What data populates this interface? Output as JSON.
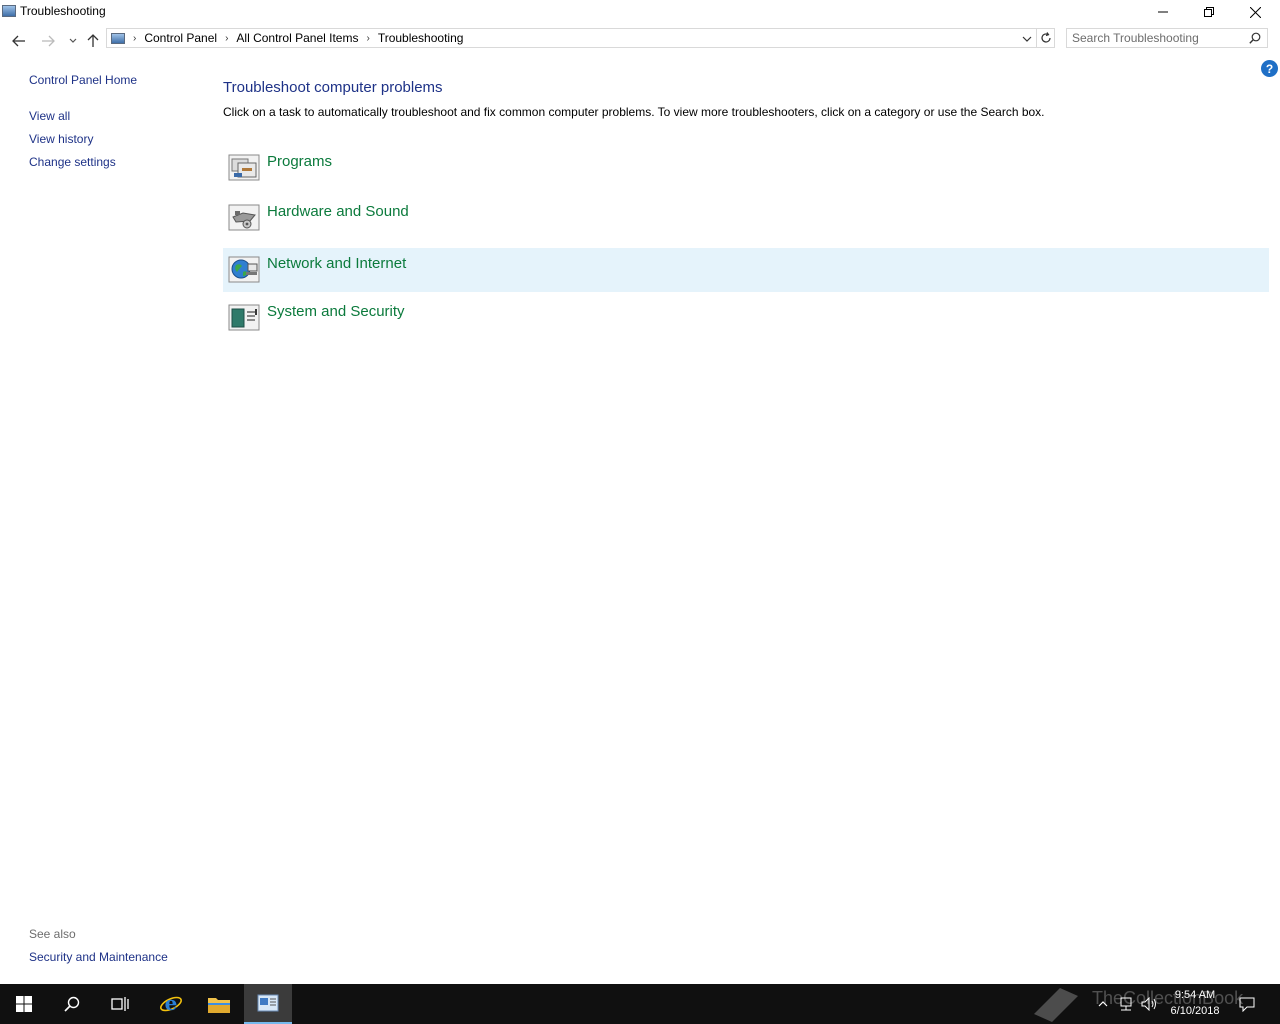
{
  "window": {
    "title": "Troubleshooting"
  },
  "address": {
    "breadcrumbs": [
      "Control Panel",
      "All Control Panel Items",
      "Troubleshooting"
    ],
    "search_placeholder": "Search Troubleshooting"
  },
  "left_pane": {
    "home": "Control Panel Home",
    "links": [
      "View all",
      "View history",
      "Change settings"
    ],
    "see_also_label": "See also",
    "see_also_links": [
      "Security and Maintenance"
    ]
  },
  "main": {
    "heading": "Troubleshoot computer problems",
    "description": "Click on a task to automatically troubleshoot and fix common computer problems. To view more troubleshooters, click on a category or use the Search box.",
    "categories": [
      {
        "label": "Programs",
        "icon": "programs-icon"
      },
      {
        "label": "Hardware and Sound",
        "icon": "hardware-sound-icon"
      },
      {
        "label": "Network and Internet",
        "icon": "network-internet-icon",
        "highlighted": true
      },
      {
        "label": "System and Security",
        "icon": "system-security-icon"
      }
    ]
  },
  "taskbar": {
    "time": "9:54 AM",
    "date": "6/10/2018",
    "watermark": "TheCollectionBook"
  },
  "colors": {
    "link": "#1e3287",
    "category_text": "#0b7a3c",
    "hover_bg": "#e5f3fb",
    "taskbar": "#101010"
  }
}
